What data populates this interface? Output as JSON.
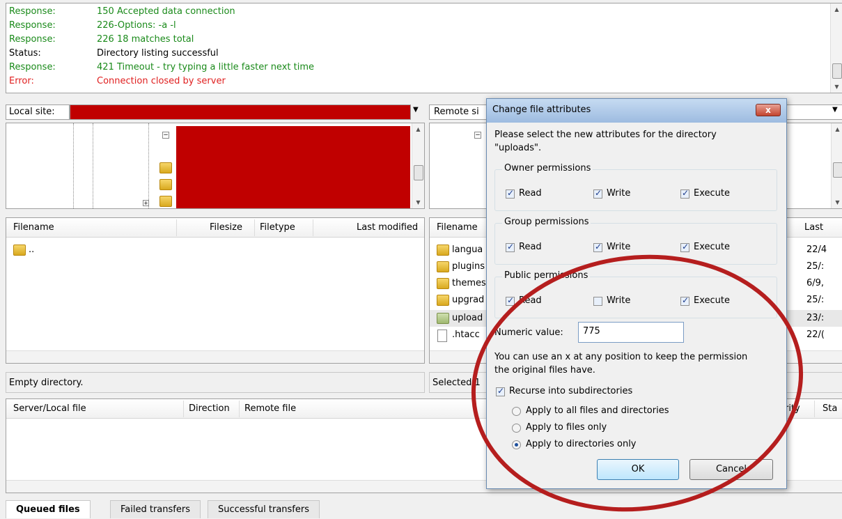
{
  "log": [
    {
      "key": "Response:",
      "value": "150 Accepted data connection",
      "color": "#1a8a1a"
    },
    {
      "key": "Response:",
      "value": "226-Options: -a -l",
      "color": "#1a8a1a"
    },
    {
      "key": "Response:",
      "value": "226 18 matches total",
      "color": "#1a8a1a"
    },
    {
      "key": "Status:",
      "value": "Directory listing successful",
      "color": "#000000"
    },
    {
      "key": "Response:",
      "value": "421 Timeout - try typing a little faster next time",
      "color": "#1a8a1a"
    },
    {
      "key": "Error:",
      "value": "Connection closed by server",
      "color": "#e02020"
    }
  ],
  "local": {
    "site_label": "Local site:",
    "columns": [
      "Filename",
      "Filesize",
      "Filetype",
      "Last modified"
    ],
    "parent_entry": "..",
    "status": "Empty directory."
  },
  "remote": {
    "site_label": "Remote si",
    "columns": [
      "Filename",
      "Last"
    ],
    "files": [
      {
        "name": "langua",
        "date": "22/4"
      },
      {
        "name": "plugins",
        "date": "25/:"
      },
      {
        "name": "themes",
        "date": "6/9,"
      },
      {
        "name": "upgrad",
        "date": "25/:"
      },
      {
        "name": "upload",
        "date": "23/:"
      },
      {
        "name": ".htacc",
        "date": "22/("
      }
    ],
    "status": "Selected 1"
  },
  "queue": {
    "columns": [
      "Server/Local file",
      "Direction",
      "Remote file",
      "Priority",
      "Sta"
    ],
    "priority_fragment": "rity"
  },
  "tabs": [
    "Queued files",
    "Failed transfers",
    "Successful transfers"
  ],
  "dialog": {
    "title": "Change file attributes",
    "close": "x",
    "intro": "Please select the new attributes for the directory \"uploads\".",
    "intro_line1": "Please select the new attributes for the directory",
    "intro_line2": "\"uploads\".",
    "groups": [
      {
        "label": "Owner permissions",
        "read": "Read",
        "write": "Write",
        "execute": "Execute"
      },
      {
        "label": "Group permissions",
        "read": "Read",
        "write": "Write",
        "execute": "Execute"
      },
      {
        "label": "Public permissions",
        "read": "Read",
        "write": "Write",
        "execute": "Execute"
      }
    ],
    "numeric_label": "Numeric value:",
    "numeric_value": "775",
    "hint_line1": "You can use an x at any position to keep the permission",
    "hint_line2": "the original files have.",
    "recurse": "Recurse into subdirectories",
    "options": [
      "Apply to all files and directories",
      "Apply to files only",
      "Apply to directories only"
    ],
    "ok": "OK",
    "cancel": "Cancel"
  },
  "colors": {
    "highlight_circle": "#b51e1e",
    "redaction": "#c00000",
    "accent": "#3c7fb1"
  }
}
